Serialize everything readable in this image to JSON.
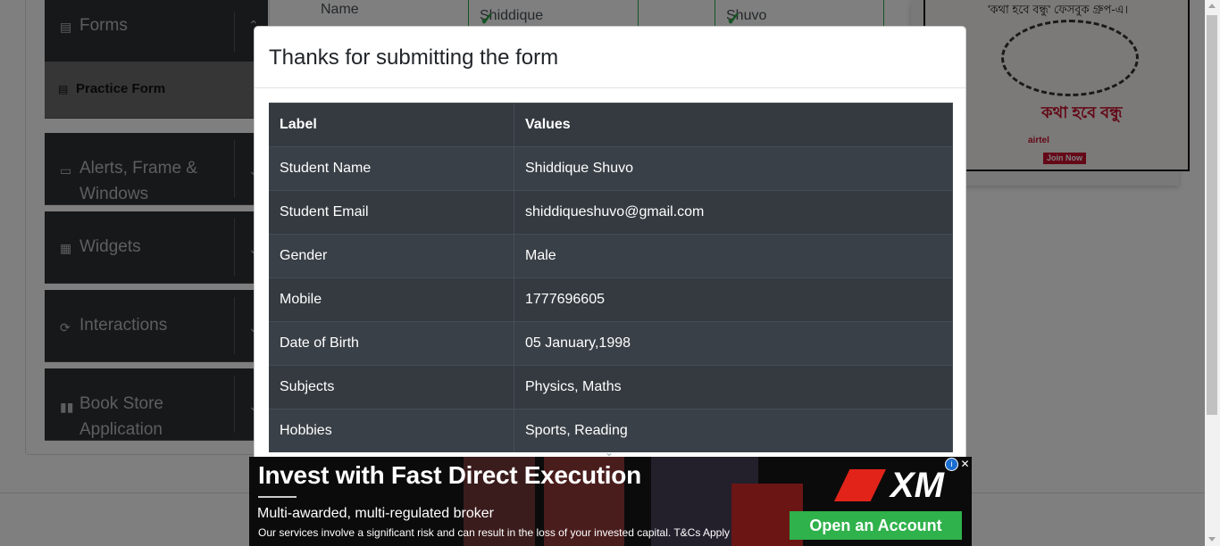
{
  "sidebar": {
    "groups": [
      {
        "label": "Forms",
        "icon": "document-icon"
      },
      {
        "label": "Alerts, Frame & Windows",
        "icon": "window-icon"
      },
      {
        "label": "Widgets",
        "icon": "widgets-icon"
      },
      {
        "label": "Interactions",
        "icon": "interactions-icon"
      },
      {
        "label": "Book Store Application",
        "icon": "books-icon"
      }
    ],
    "active_item": "Practice Form"
  },
  "form": {
    "name_label": "Name",
    "first_name": "Shiddique",
    "last_name": "Shuvo"
  },
  "side_ad": {
    "text": "'কথা হবে বন্ধু' ফেসবুক গ্রুপ-এ।",
    "brand": "কথা হবে বন্ধু",
    "sponsor": "airtel",
    "cta": "Join Now"
  },
  "modal": {
    "title": "Thanks for submitting the form",
    "columns": [
      "Label",
      "Values"
    ],
    "rows": [
      {
        "label": "Student Name",
        "value": "Shiddique Shuvo"
      },
      {
        "label": "Student Email",
        "value": "shiddiqueshuvo@gmail.com"
      },
      {
        "label": "Gender",
        "value": "Male"
      },
      {
        "label": "Mobile",
        "value": "1777696605"
      },
      {
        "label": "Date of Birth",
        "value": "05 January,1998"
      },
      {
        "label": "Subjects",
        "value": "Physics, Maths"
      },
      {
        "label": "Hobbies",
        "value": "Sports, Reading"
      }
    ]
  },
  "bottom_ad": {
    "headline": "Invest with Fast Direct Execution",
    "subline": "Multi-awarded, multi-regulated broker",
    "disclaimer": "Our services involve a significant risk and can result in the loss of your invested capital. T&Cs Apply",
    "logo": "XM",
    "cta": "Open an Account",
    "cta_color": "#2fb14b"
  },
  "colors": {
    "sidebar_bg": "#2e3033",
    "table_bg": "#343a40",
    "valid_green": "#28a745"
  }
}
